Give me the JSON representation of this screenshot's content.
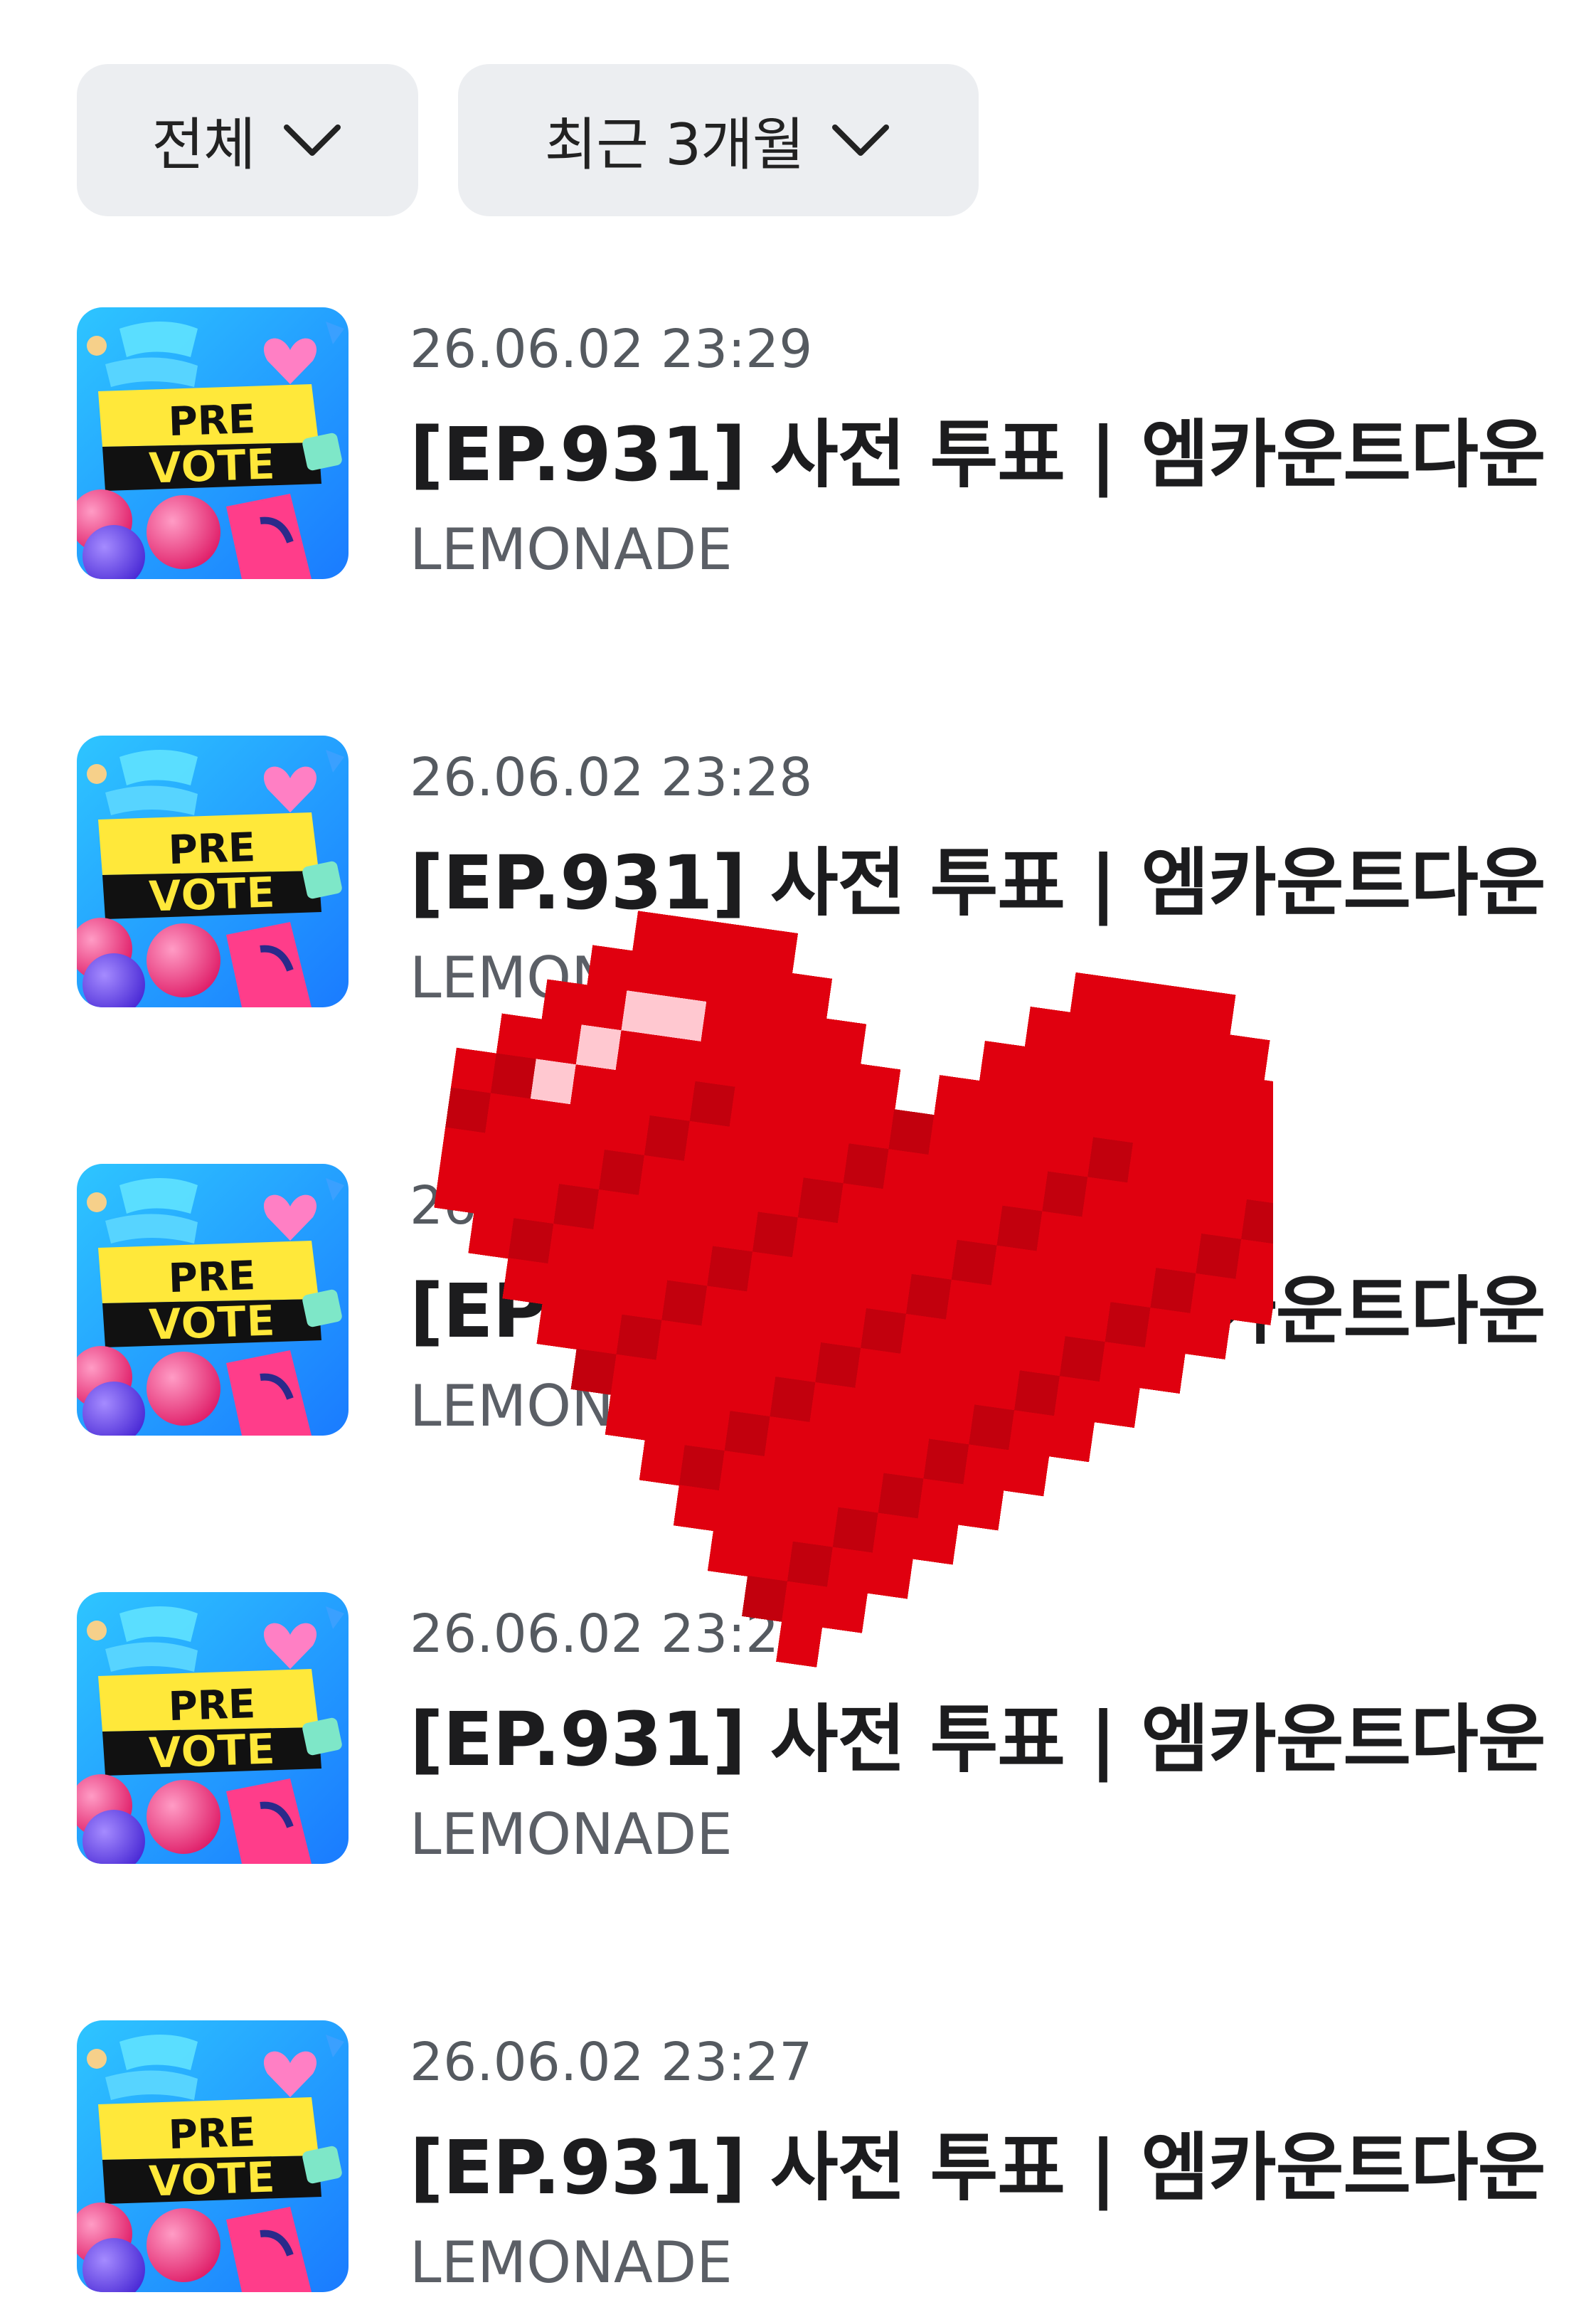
{
  "filters": {
    "category_label": "전체",
    "period_label": "최근 3개월"
  },
  "thumbnail": {
    "line1": "PRE",
    "line2": "VOTE"
  },
  "items": [
    {
      "date": "26.06.02 23:29",
      "title": "[EP.931] 사전 투표 | 엠카운트다운",
      "artist": "LEMONADE"
    },
    {
      "date": "26.06.02 23:28",
      "title": "[EP.931] 사전 투표 | 엠카운트다운",
      "artist": "LEMONADE"
    },
    {
      "date": "26.06.02 23:28",
      "title": "[EP.931] 사전 투표 | 엠카운트다운",
      "artist": "LEMONADE"
    },
    {
      "date": "26.06.02 23:27",
      "title": "[EP.931] 사전 투표 | 엠카운트다운",
      "artist": "LEMONADE"
    },
    {
      "date": "26.06.02 23:27",
      "title": "[EP.931] 사전 투표 | 엠카운트다운",
      "artist": "LEMONADE"
    }
  ],
  "overlay": {
    "icon": "pixel-heart-icon",
    "color": "#e0000f"
  },
  "colors": {
    "chip_bg": "#eceef1",
    "thumb_yellow": "#ffe83a",
    "thumb_pink": "#ff4f9a",
    "thumb_blue": "#33b4ff"
  }
}
